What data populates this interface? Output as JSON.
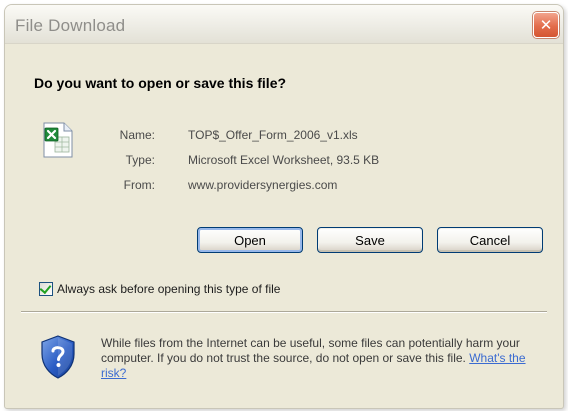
{
  "window": {
    "title": "File Download",
    "close_label": "✕"
  },
  "dialog": {
    "question": "Do you want to open or save this file?"
  },
  "file": {
    "name_label": "Name:",
    "name_value": "TOP$_Offer_Form_2006_v1.xls",
    "type_label": "Type:",
    "type_value": "Microsoft Excel Worksheet, 93.5 KB",
    "from_label": "From:",
    "from_value": "www.providersynergies.com",
    "icon": "excel-file-icon"
  },
  "buttons": {
    "open": "Open",
    "save": "Save",
    "cancel": "Cancel"
  },
  "checkbox": {
    "label": "Always ask before opening this type of file",
    "checked": true
  },
  "warning": {
    "text": "While files from the Internet can be useful, some files can potentially harm your computer. If you do not trust the source, do not open or save this file.",
    "link": "What's the risk?",
    "icon": "shield-question-icon"
  },
  "colors": {
    "dialog_bg": "#ece9d8",
    "close_button": "#e36d4c",
    "link": "#3b6bd1",
    "check": "#21a121"
  }
}
